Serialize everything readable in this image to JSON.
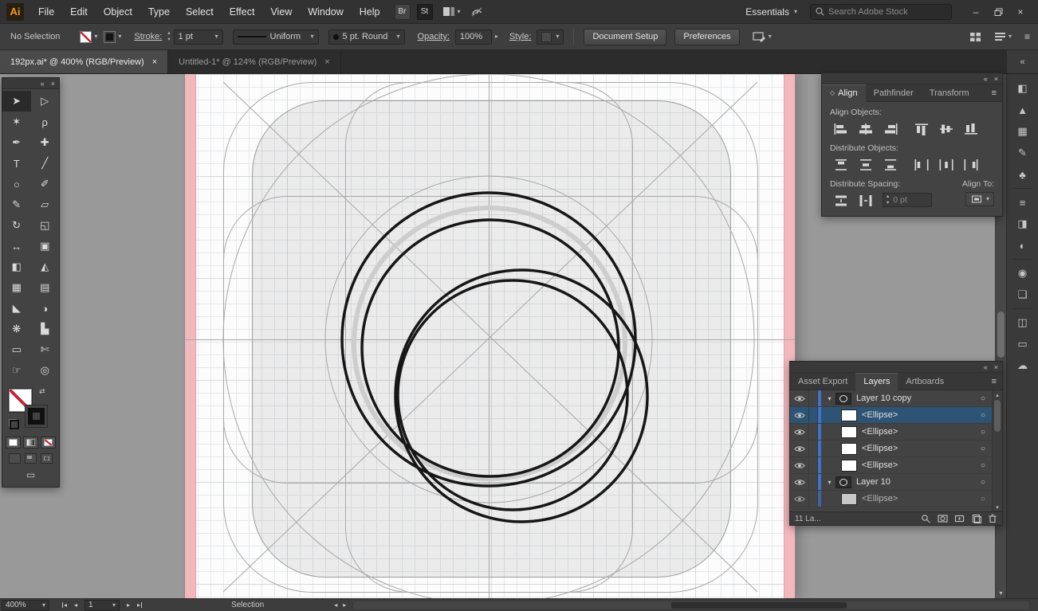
{
  "colors": {
    "accent_orange": "#f7971d",
    "selection_blue": "#2d5474",
    "layer_color_blue": "#3f72c8",
    "artboard_margin_pink": "#f3b8bc",
    "artwork_stroke": "#161616"
  },
  "icons": {
    "chevron_down": "▾",
    "chevron_up": "▴",
    "chevron_left": "◂",
    "chevron_right": "▸",
    "double_chevron_left": "«",
    "close": "×",
    "menu": "≡",
    "target": "○",
    "swap": "⇄",
    "minimize": "–",
    "diamond": "◇"
  },
  "menubar": {
    "logo": "Ai",
    "items": [
      "File",
      "Edit",
      "Object",
      "Type",
      "Select",
      "Effect",
      "View",
      "Window",
      "Help"
    ],
    "bridge_label": "Br",
    "stock_label": "St",
    "workspace": "Essentials",
    "search_placeholder": "Search Adobe Stock"
  },
  "controlbar": {
    "selection_status": "No Selection",
    "stroke_label": "Stroke:",
    "stroke_weight": "1 pt",
    "stroke_profile": "Uniform",
    "brush": "5 pt. Round",
    "opacity_label": "Opacity:",
    "opacity_value": "100%",
    "style_label": "Style:",
    "document_setup_label": "Document Setup",
    "preferences_label": "Preferences"
  },
  "doc_tabs": [
    {
      "label": "192px.ai* @ 400% (RGB/Preview)",
      "active": true
    },
    {
      "label": "Untitled-1* @ 124% (RGB/Preview)",
      "active": false
    }
  ],
  "toolbar": {
    "tools": [
      {
        "name": "selection-tool",
        "glyph": "➤"
      },
      {
        "name": "direct-selection-tool",
        "glyph": "▷"
      },
      {
        "name": "magic-wand-tool",
        "glyph": "✶"
      },
      {
        "name": "lasso-tool",
        "glyph": "ρ"
      },
      {
        "name": "pen-tool",
        "glyph": "✒"
      },
      {
        "name": "add-anchor-point-tool",
        "glyph": "✚"
      },
      {
        "name": "type-tool",
        "glyph": "T"
      },
      {
        "name": "line-segment-tool",
        "glyph": "╱"
      },
      {
        "name": "ellipse-tool",
        "glyph": "○"
      },
      {
        "name": "paintbrush-tool",
        "glyph": "✐"
      },
      {
        "name": "pencil-tool",
        "glyph": "✎"
      },
      {
        "name": "eraser-tool",
        "glyph": "▱"
      },
      {
        "name": "rotate-tool",
        "glyph": "↻"
      },
      {
        "name": "scale-tool",
        "glyph": "◱"
      },
      {
        "name": "width-tool",
        "glyph": "↔"
      },
      {
        "name": "free-transform-tool",
        "glyph": "▣"
      },
      {
        "name": "shape-builder-tool",
        "glyph": "◧"
      },
      {
        "name": "perspective-grid-tool",
        "glyph": "◭"
      },
      {
        "name": "mesh-tool",
        "glyph": "▦"
      },
      {
        "name": "gradient-tool",
        "glyph": "▤"
      },
      {
        "name": "eyedropper-tool",
        "glyph": "◣"
      },
      {
        "name": "blend-tool",
        "glyph": "◑"
      },
      {
        "name": "symbol-sprayer-tool",
        "glyph": "❋"
      },
      {
        "name": "column-graph-tool",
        "glyph": "▙"
      },
      {
        "name": "artboard-tool",
        "glyph": "▭"
      },
      {
        "name": "slice-tool",
        "glyph": "✄"
      },
      {
        "name": "hand-tool",
        "glyph": "☞"
      },
      {
        "name": "zoom-tool",
        "glyph": "◎"
      }
    ]
  },
  "align_panel": {
    "tabs": [
      "Align",
      "Pathfinder",
      "Transform"
    ],
    "align_objects_label": "Align Objects:",
    "distribute_objects_label": "Distribute Objects:",
    "distribute_spacing_label": "Distribute Spacing:",
    "align_to_label": "Align To:",
    "spacing_value": "0 pt",
    "align_buttons": [
      "horizontal-align-left",
      "horizontal-align-center",
      "horizontal-align-right",
      "vertical-align-top",
      "vertical-align-center",
      "vertical-align-bottom"
    ],
    "distribute_buttons": [
      "vertical-distribute-top",
      "vertical-distribute-center",
      "vertical-distribute-bottom",
      "horizontal-distribute-left",
      "horizontal-distribute-center",
      "horizontal-distribute-right"
    ],
    "spacing_buttons": [
      "vertical-distribute-space",
      "horizontal-distribute-space"
    ],
    "align_to_button": "align-to-artboard"
  },
  "layers_panel": {
    "tabs": [
      "Asset Export",
      "Layers",
      "Artboards"
    ],
    "rows": [
      {
        "name": "Layer 10 copy",
        "kind": "layer",
        "expanded": true,
        "visible": true,
        "selected": false
      },
      {
        "name": "<Ellipse>",
        "kind": "object",
        "visible": true,
        "selected": true
      },
      {
        "name": "<Ellipse>",
        "kind": "object",
        "visible": true,
        "selected": false
      },
      {
        "name": "<Ellipse>",
        "kind": "object",
        "visible": true,
        "selected": false
      },
      {
        "name": "<Ellipse>",
        "kind": "object",
        "visible": true,
        "selected": false
      },
      {
        "name": "Layer 10",
        "kind": "layer",
        "expanded": true,
        "visible": true,
        "selected": false
      },
      {
        "name": "<Ellipse>",
        "kind": "object",
        "visible": true,
        "selected": false
      }
    ],
    "footer_status": "11 La...",
    "footer_buttons": [
      "locate-object",
      "make-clip-mask",
      "new-sublayer",
      "new-layer",
      "delete-selection"
    ]
  },
  "panel_strip": {
    "panels": [
      {
        "name": "color-panel",
        "glyph": "◧"
      },
      {
        "name": "color-guide-panel",
        "glyph": "▲"
      },
      {
        "name": "swatches-panel",
        "glyph": "▦"
      },
      {
        "name": "brushes-panel",
        "glyph": "✎"
      },
      {
        "name": "symbols-panel",
        "glyph": "♣"
      },
      {
        "name": "stroke-panel",
        "glyph": "≡"
      },
      {
        "name": "gradient-panel",
        "glyph": "◨"
      },
      {
        "name": "transparency-panel",
        "glyph": "◐"
      },
      {
        "name": "appearance-panel",
        "glyph": "◉"
      },
      {
        "name": "graphic-styles-panel",
        "glyph": "❏"
      },
      {
        "name": "layers-panel",
        "glyph": "◫"
      },
      {
        "name": "artboards-panel",
        "glyph": "▭"
      },
      {
        "name": "libraries-panel",
        "glyph": "☁"
      }
    ]
  },
  "statusbar": {
    "zoom": "400%",
    "artboard_number": "1",
    "status": "Selection"
  }
}
